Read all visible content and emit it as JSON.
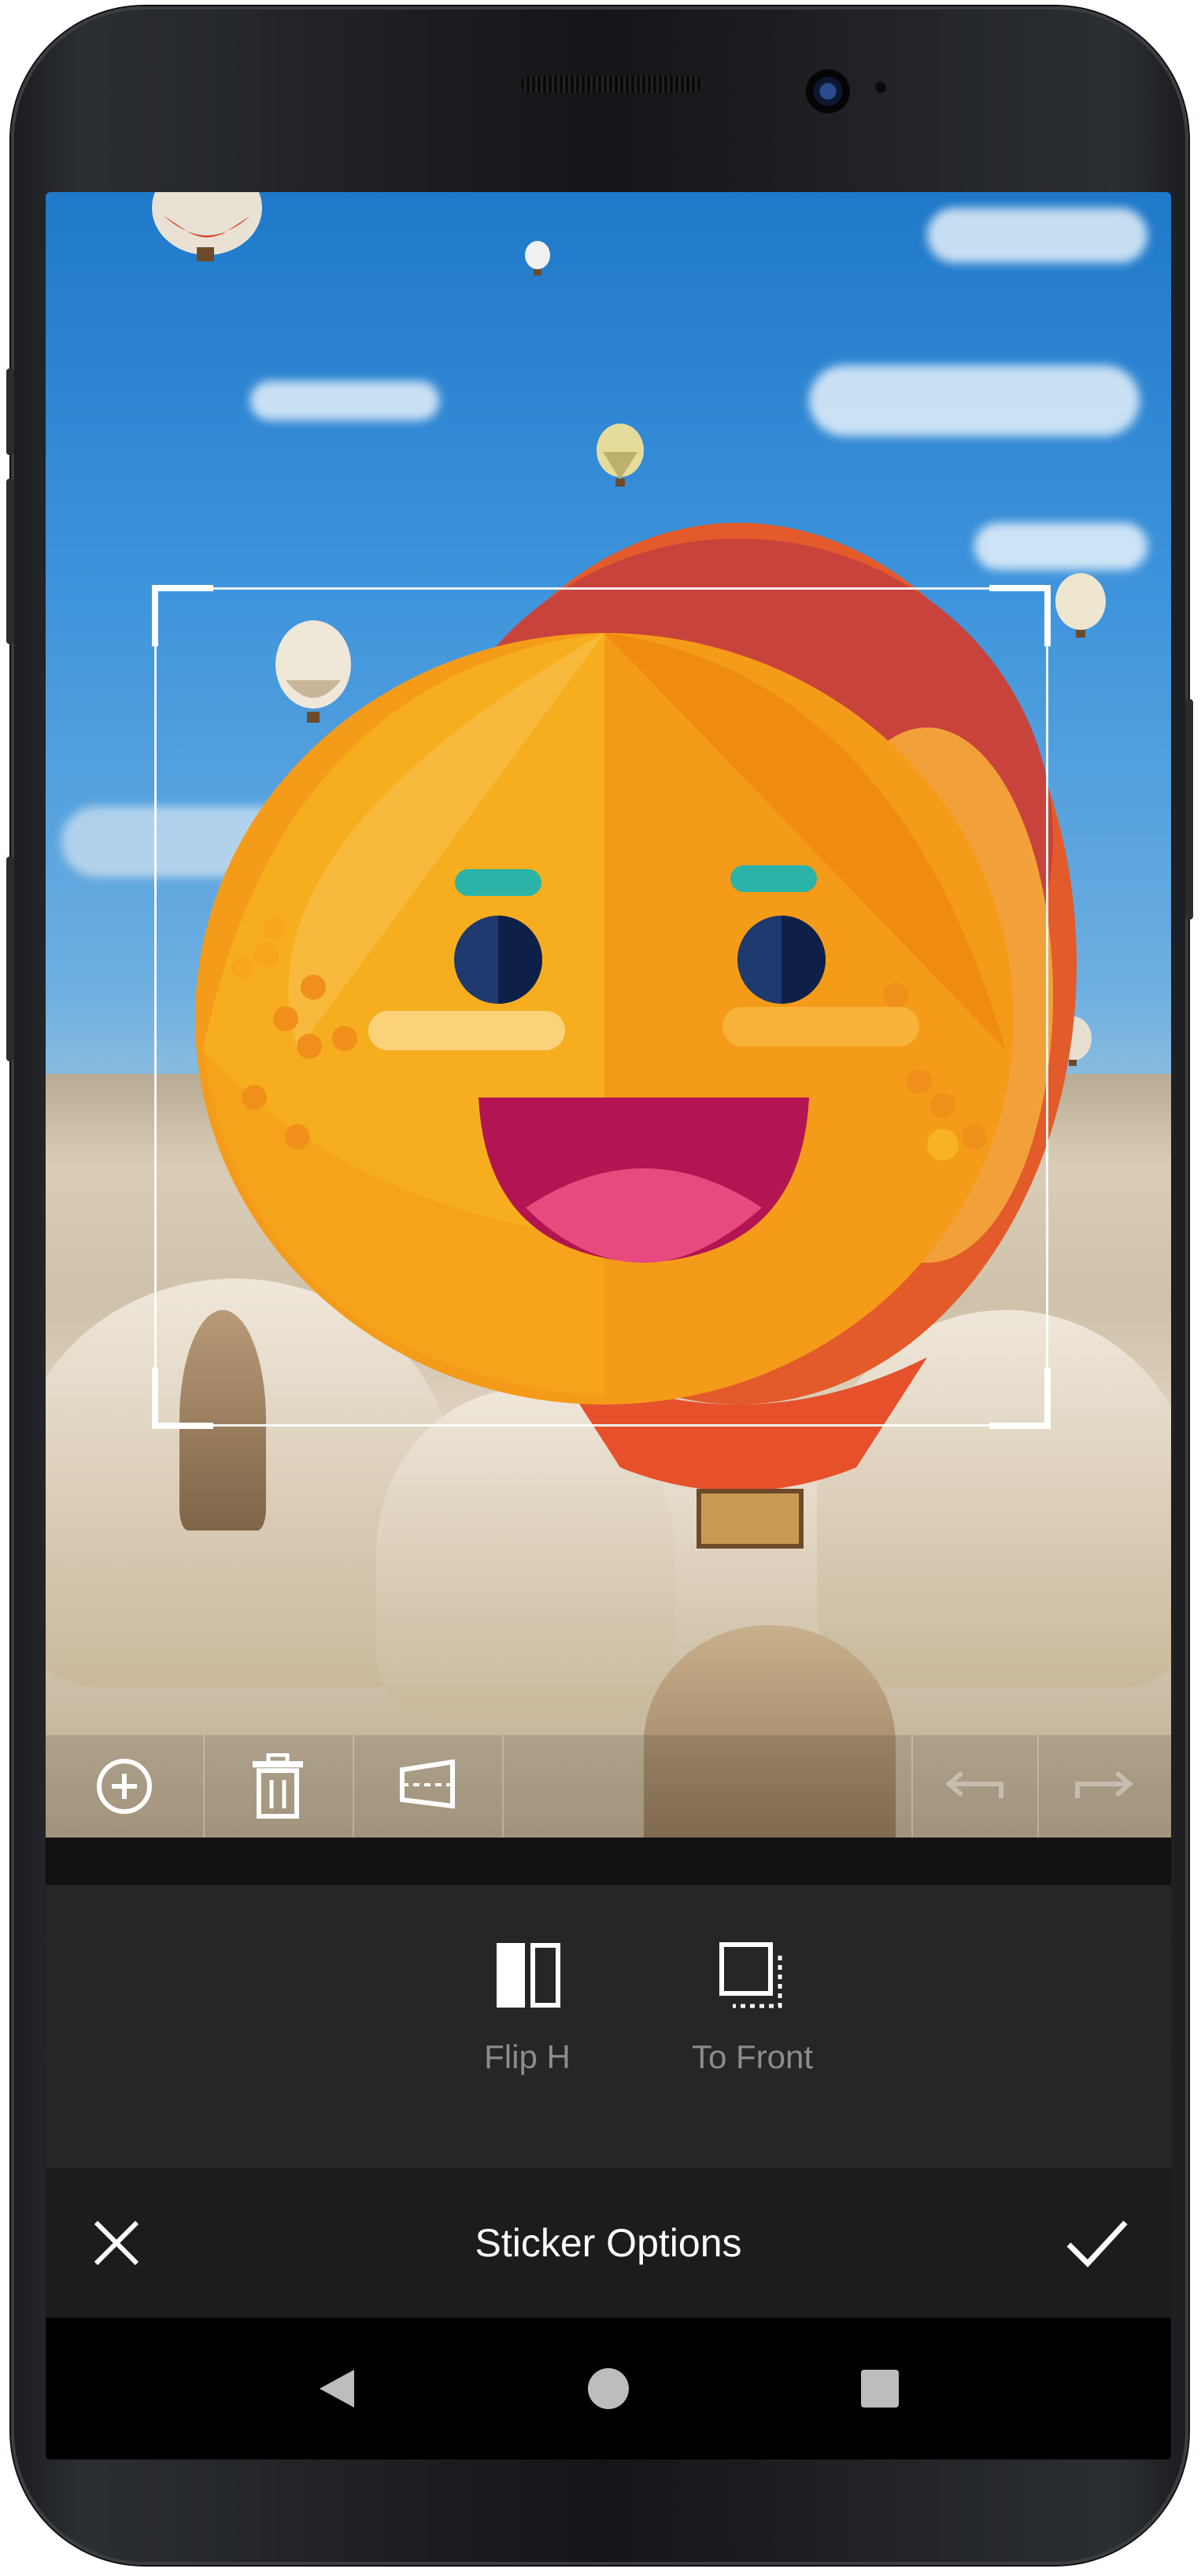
{
  "photo": {
    "toolbar": {
      "add_icon": "plus-circle-icon",
      "delete_icon": "trash-icon",
      "transform_icon": "perspective-icon",
      "undo_icon": "undo-arrow-icon",
      "redo_icon": "redo-arrow-icon"
    },
    "sticker": {
      "name": "smiling-face-sticker",
      "colors": {
        "face": "#f5a623",
        "face_dark": "#f39c12",
        "mouth": "#c2185b",
        "tongue": "#e84a7f",
        "eyes": "#1e3a6e",
        "brows": "#2ab3a6"
      }
    }
  },
  "options": [
    {
      "label": "Flip H",
      "icon": "flip-horizontal-icon"
    },
    {
      "label": "To Front",
      "icon": "bring-to-front-icon"
    }
  ],
  "bottom_bar": {
    "title": "Sticker Options",
    "cancel_icon": "close-icon",
    "confirm_icon": "checkmark-icon"
  },
  "nav": {
    "back_icon": "back-triangle-icon",
    "home_icon": "home-circle-icon",
    "recents_icon": "recents-square-icon"
  },
  "colors": {
    "panel": "#262626",
    "bottom_bar": "#1c1c1c",
    "label_inactive": "#8c8c8c",
    "title": "#ffffff"
  }
}
